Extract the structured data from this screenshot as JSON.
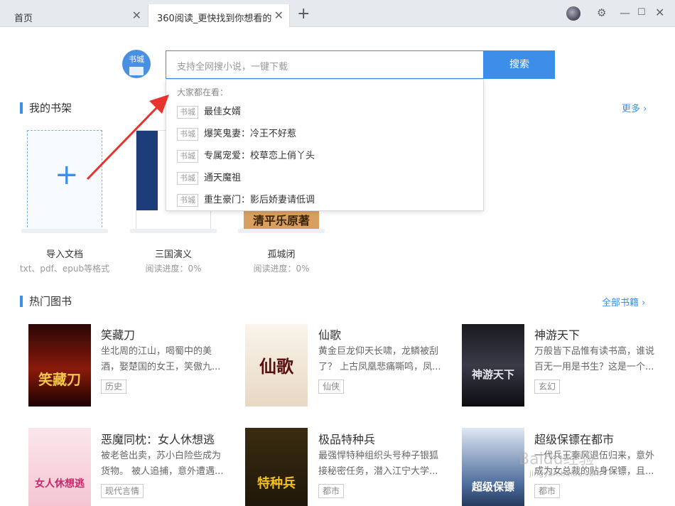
{
  "tabs": [
    {
      "label": "首页"
    },
    {
      "label": "360阅读_更快找到你想看的"
    }
  ],
  "new_tab_label": "+",
  "logo_label": "书城",
  "search": {
    "placeholder": "支持全网搜小说，一键下载",
    "button": "搜索",
    "dropdown_heading": "大家都在看：",
    "suggestions": [
      {
        "tag": "书城",
        "text": "最佳女婿"
      },
      {
        "tag": "书城",
        "text": "爆笑鬼妻：冷王不好惹"
      },
      {
        "tag": "书城",
        "text": "专属宠爱：校草恋上俏丫头"
      },
      {
        "tag": "书城",
        "text": "通天魔祖"
      },
      {
        "tag": "书城",
        "text": "重生豪门：影后娇妻请低调"
      }
    ]
  },
  "shelf": {
    "title": "我的书架",
    "more": "更多 ›",
    "import": {
      "label": "导入文档",
      "sub": "txt、pdf、epub等格式"
    },
    "books": [
      {
        "name": "三国演义",
        "progress": "阅读进度：0%"
      },
      {
        "name": "孤城闭",
        "progress": "阅读进度：0%",
        "cover_text": "清平乐原著"
      }
    ]
  },
  "hot": {
    "title": "热门图书",
    "more": "全部书籍 ›",
    "books": [
      {
        "title": "笑藏刀",
        "desc1": "坐北周的江山，喝蜀中的美",
        "desc2": "酒，娶楚国的女王，笑傲九...",
        "tag": "历史",
        "cover": "笑藏刀"
      },
      {
        "title": "仙歌",
        "desc1": "黄金巨龙仰天长啸，龙鳞被刮",
        "desc2": "了？ 上古凤凰悲痛嘶鸣，凤...",
        "tag": "仙侠",
        "cover": "仙歌"
      },
      {
        "title": "神游天下",
        "desc1": "万般皆下品惟有读书高，谁说",
        "desc2": "百无一用是书生？这是一个...",
        "tag": "玄幻",
        "cover": "神游天下"
      },
      {
        "title": "恶魔同枕：女人休想逃",
        "desc1": "被老爸出卖，苏小白险些成为",
        "desc2": "货物。 被人追捕，意外遭遇...",
        "tag": "现代言情",
        "cover": "女人休想逃"
      },
      {
        "title": "极品特种兵",
        "desc1": "最强悍特种组织头号种子银狐",
        "desc2": "接秘密任务，潜入江宁大学...",
        "tag": "都市",
        "cover": "特种兵"
      },
      {
        "title": "超级保镖在都市",
        "desc1": "一代兵王秦风退伍归来，意外",
        "desc2": "成为女总裁的贴身保镖，且...",
        "tag": "都市",
        "cover": "超级保镖"
      }
    ]
  },
  "watermark": "Baidu经验",
  "watermark_url": "jingyan.baidu.com",
  "colors": {
    "accent": "#3c8ee8",
    "arrow": "#e8322e"
  }
}
